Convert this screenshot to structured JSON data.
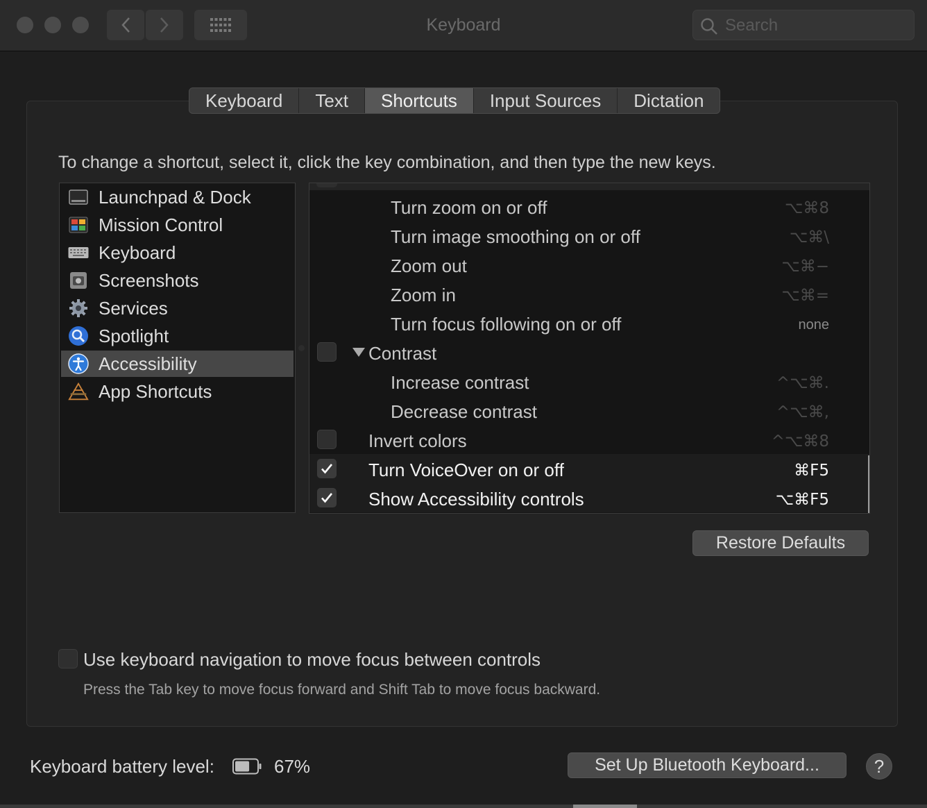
{
  "window": {
    "title": "Keyboard",
    "search_placeholder": "Search"
  },
  "tabs": [
    {
      "label": "Keyboard",
      "active": false
    },
    {
      "label": "Text",
      "active": false
    },
    {
      "label": "Shortcuts",
      "active": true
    },
    {
      "label": "Input Sources",
      "active": false
    },
    {
      "label": "Dictation",
      "active": false
    }
  ],
  "instruction": "To change a shortcut, select it, click the key combination, and then type the new keys.",
  "categories": [
    {
      "label": "Launchpad & Dock",
      "icon": "launchpad-dock-icon"
    },
    {
      "label": "Mission Control",
      "icon": "mission-control-icon"
    },
    {
      "label": "Keyboard",
      "icon": "keyboard-icon"
    },
    {
      "label": "Screenshots",
      "icon": "screenshots-icon"
    },
    {
      "label": "Services",
      "icon": "gear-icon"
    },
    {
      "label": "Spotlight",
      "icon": "spotlight-icon"
    },
    {
      "label": "Accessibility",
      "icon": "accessibility-icon",
      "selected": true
    },
    {
      "label": "App Shortcuts",
      "icon": "app-shortcuts-icon"
    }
  ],
  "shortcuts": [
    {
      "label": "Turn zoom on or off",
      "keys": "⌥⌘8",
      "enabled": false
    },
    {
      "label": "Turn image smoothing on or off",
      "keys": "⌥⌘\\",
      "enabled": false
    },
    {
      "label": "Zoom out",
      "keys": "⌥⌘−",
      "enabled": false
    },
    {
      "label": "Zoom in",
      "keys": "⌥⌘=",
      "enabled": false
    },
    {
      "label": "Turn focus following on or off",
      "keys": "none",
      "enabled": false
    },
    {
      "label": "Contrast",
      "keys": "",
      "enabled": false,
      "group": true,
      "expanded": true
    },
    {
      "label": "Increase contrast",
      "keys": "^⌥⌘.",
      "enabled": false
    },
    {
      "label": "Decrease contrast",
      "keys": "^⌥⌘,",
      "enabled": false
    },
    {
      "label": "Invert colors",
      "keys": "^⌥⌘8",
      "enabled": false
    },
    {
      "label": "Turn VoiceOver on or off",
      "keys": "⌘F5",
      "enabled": true
    },
    {
      "label": "Show Accessibility controls",
      "keys": "⌥⌘F5",
      "enabled": true
    }
  ],
  "restore_defaults": "Restore Defaults",
  "keyboard_navigation": {
    "label": "Use keyboard navigation to move focus between controls",
    "hint": "Press the Tab key to move focus forward and Shift Tab to move focus backward.",
    "checked": false
  },
  "battery": {
    "label": "Keyboard battery level:",
    "value": "67%",
    "level": 0.67
  },
  "bluetooth_button": "Set Up Bluetooth Keyboard...",
  "help": "?"
}
